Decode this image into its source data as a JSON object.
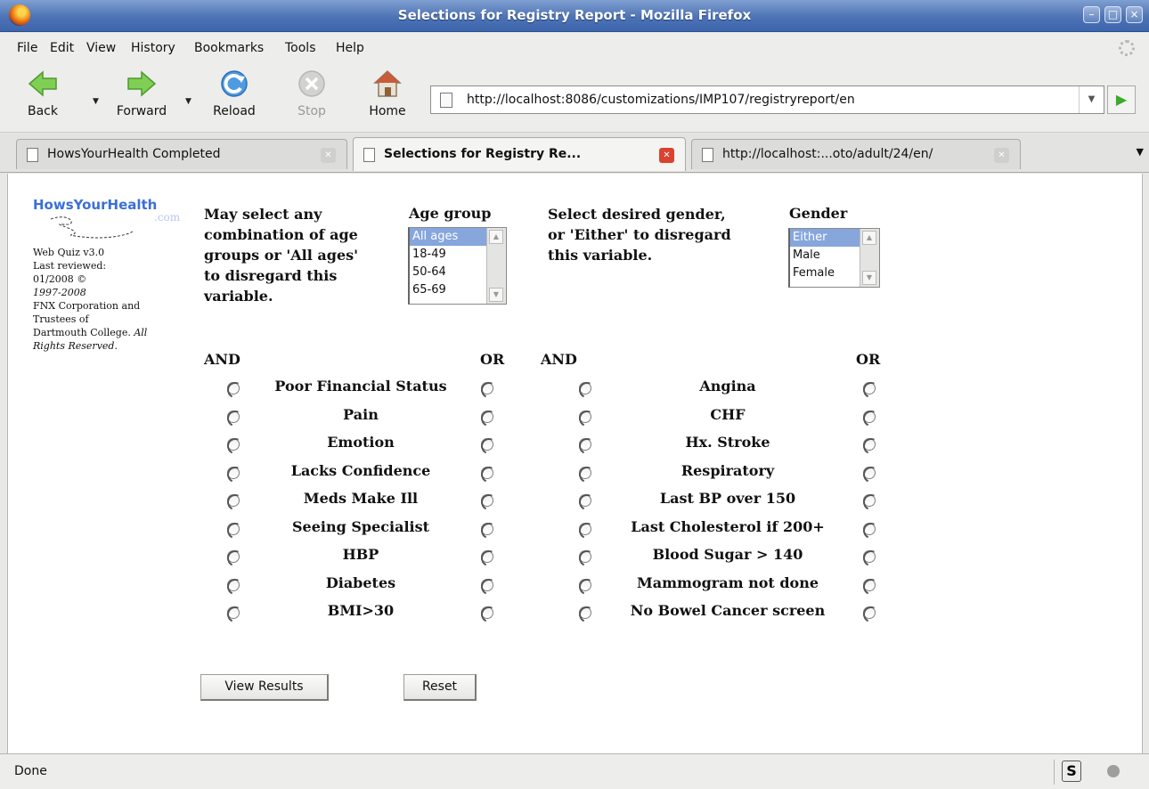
{
  "window": {
    "title": "Selections for Registry Report - Mozilla Firefox"
  },
  "menu": [
    "File",
    "Edit",
    "View",
    "History",
    "Bookmarks",
    "Tools",
    "Help"
  ],
  "nav": {
    "back": "Back",
    "forward": "Forward",
    "reload": "Reload",
    "stop": "Stop",
    "home": "Home",
    "url": "http://localhost:8086/customizations/IMP107/registryreport/en"
  },
  "tabs": [
    {
      "label": "HowsYourHealth Completed",
      "active": false
    },
    {
      "label": "Selections for Registry Re...",
      "active": true
    },
    {
      "label": "http://localhost:...oto/adult/24/en/",
      "active": false
    }
  ],
  "sidebar": {
    "logo": "HowsYourHealth",
    "logo_suffix": ".com",
    "version": "Web Quiz v3.0",
    "reviewed": "Last reviewed:",
    "reviewed_date": "01/2008 ©",
    "years": "1997-2008",
    "org1": "FNX Corporation and",
    "org2": "Trustees of",
    "org3": "Dartmouth College.",
    "rights1": "All",
    "rights2": "Rights Reserved."
  },
  "age": {
    "instruction": [
      "May select any",
      "combination of age",
      "groups or 'All ages'",
      "to disregard this",
      "variable."
    ],
    "header": "Age group",
    "options": [
      "All ages",
      "18-49",
      "50-64",
      "65-69"
    ],
    "selected": "All ages"
  },
  "gender": {
    "instruction": [
      "Select desired gender,",
      "or 'Either' to disregard",
      "this variable."
    ],
    "header": "Gender",
    "options": [
      "Either",
      "Male",
      "Female"
    ],
    "selected": "Either"
  },
  "conditions": {
    "and_label": "AND",
    "or_label": "OR",
    "left": [
      "Poor Financial Status",
      "Pain",
      "Emotion",
      "Lacks Confidence",
      "Meds Make Ill",
      "Seeing Specialist",
      "HBP",
      "Diabetes",
      "BMI>30"
    ],
    "right": [
      "Angina",
      "CHF",
      "Hx. Stroke",
      "Respiratory",
      "Last BP over 150",
      "Last Cholesterol if 200+",
      "Blood Sugar > 140",
      "Mammogram not done",
      "No Bowel Cancer screen"
    ]
  },
  "buttons": {
    "view": "View Results",
    "reset": "Reset"
  },
  "status": {
    "text": "Done"
  }
}
